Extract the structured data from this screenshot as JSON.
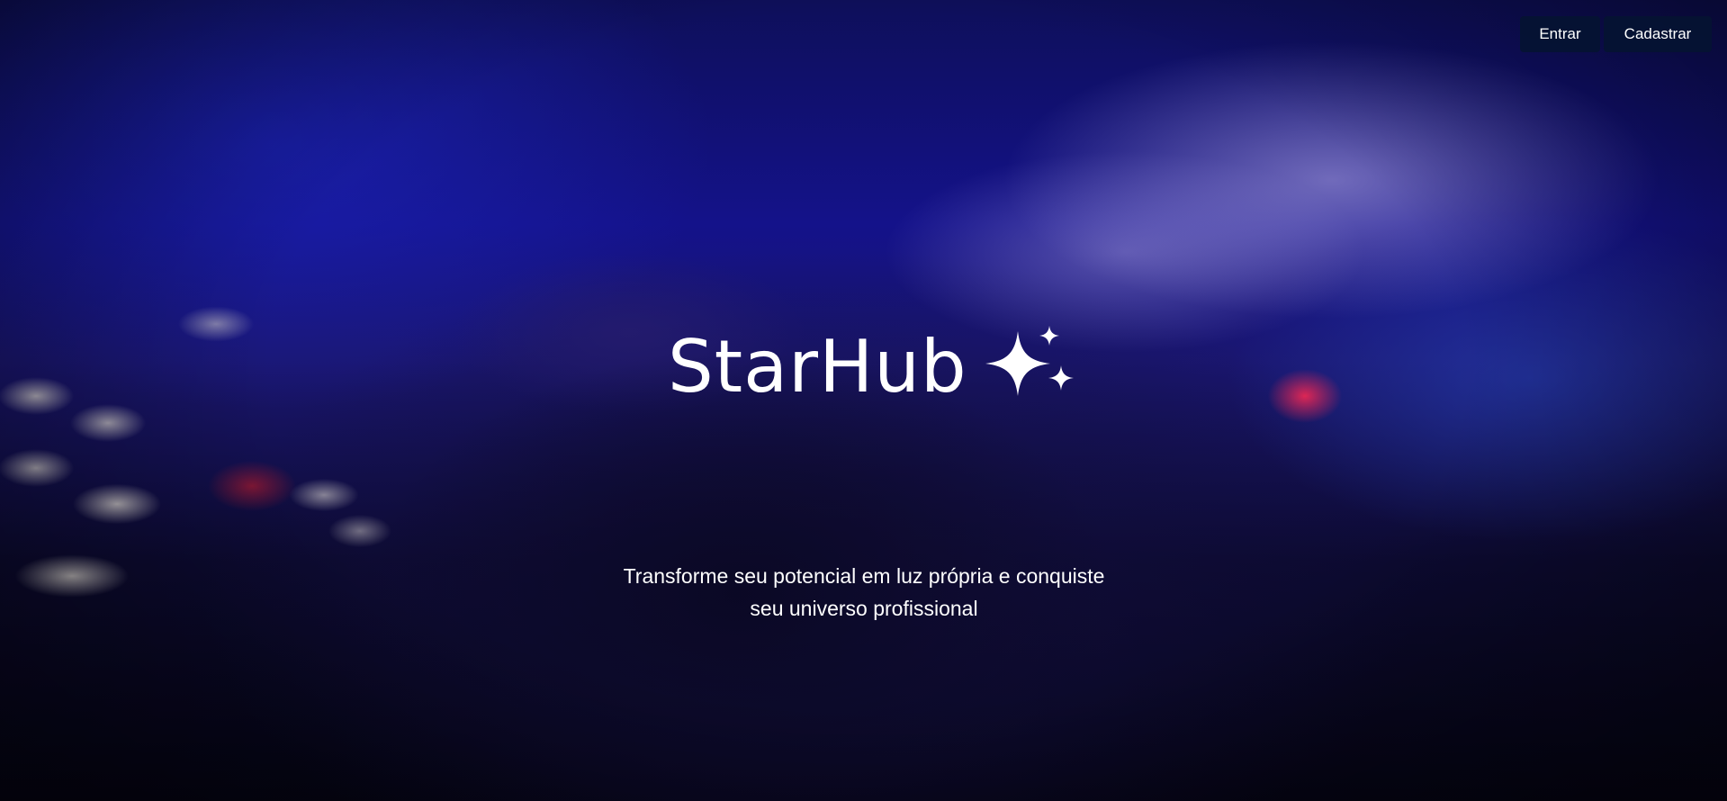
{
  "header": {
    "login_label": "Entrar",
    "signup_label": "Cadastrar"
  },
  "hero": {
    "brand_name": "StarHub",
    "brand_icon": "sparkles-icon",
    "tagline_line1": "Transforme seu potencial em luz própria e conquiste",
    "tagline_line2": "seu universo profissional"
  },
  "colors": {
    "button_bg": "#051432",
    "text": "#ffffff",
    "background_accent": "#14128a"
  }
}
